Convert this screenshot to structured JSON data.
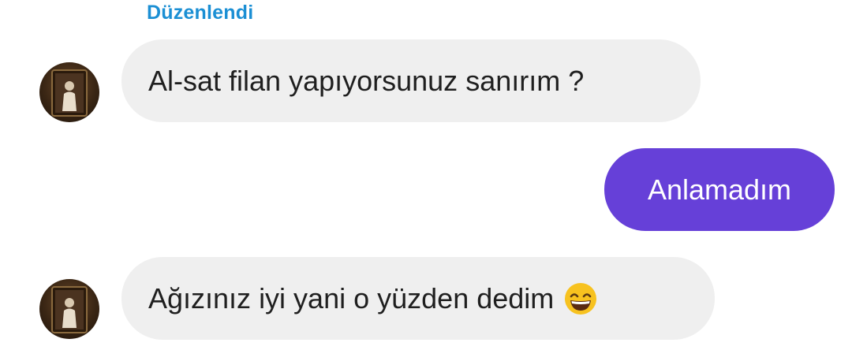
{
  "conversation": {
    "edited_label": "Düzenlendi",
    "messages": [
      {
        "direction": "incoming",
        "text": "Al-sat filan yapıyorsunuz sanırım ?"
      },
      {
        "direction": "outgoing",
        "text": "Anlamadım"
      },
      {
        "direction": "incoming",
        "text": "Ağızınız iyi yani o yüzden dedim",
        "emoji": "grinning-face-with-smiling-eyes"
      }
    ]
  },
  "colors": {
    "edited_label": "#1b8fd4",
    "incoming_bubble": "#efefef",
    "outgoing_bubble": "#6640d8",
    "incoming_text": "#1f1f1f",
    "outgoing_text": "#ffffff"
  }
}
